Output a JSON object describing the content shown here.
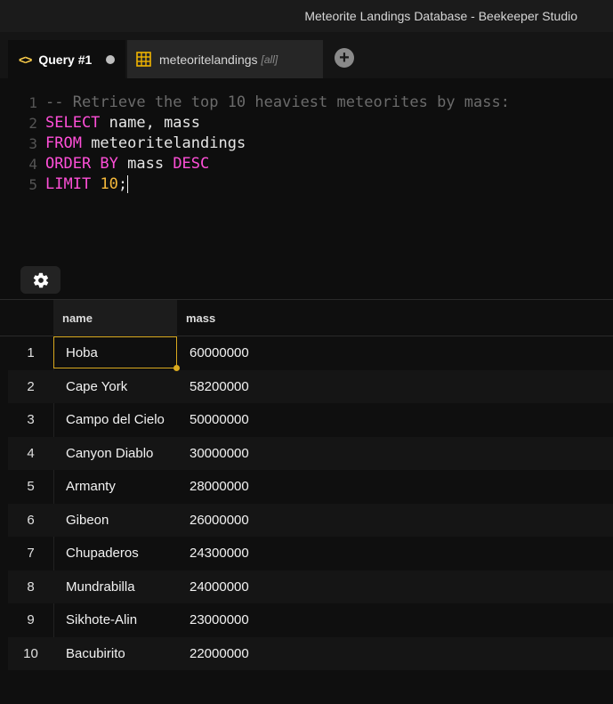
{
  "window": {
    "title": "Meteorite Landings Database - Beekeeper Studio"
  },
  "tabs": [
    {
      "label": "Query #1",
      "icon": "code-icon",
      "active": true,
      "unsaved": true
    },
    {
      "label": "meteoritelandings",
      "suffix": "[all]",
      "icon": "table-grid-icon",
      "active": false
    }
  ],
  "editor": {
    "line_numbers": [
      "1",
      "2",
      "3",
      "4",
      "5"
    ],
    "lines": [
      [
        {
          "t": "cm",
          "s": "-- Retrieve the top 10 heaviest meteorites by mass:"
        }
      ],
      [
        {
          "t": "kw",
          "s": "SELECT"
        },
        {
          "t": "tx",
          "s": " name, mass"
        }
      ],
      [
        {
          "t": "kw",
          "s": "FROM"
        },
        {
          "t": "tx",
          "s": " meteoritelandings"
        }
      ],
      [
        {
          "t": "kw",
          "s": "ORDER BY"
        },
        {
          "t": "tx",
          "s": " mass "
        },
        {
          "t": "kw",
          "s": "DESC"
        }
      ],
      [
        {
          "t": "kw",
          "s": "LIMIT"
        },
        {
          "t": "tx",
          "s": " "
        },
        {
          "t": "num",
          "s": "10"
        },
        {
          "t": "tx",
          "s": ";"
        }
      ]
    ]
  },
  "results": {
    "columns": [
      "name",
      "mass"
    ],
    "rows": [
      {
        "index": "1",
        "name": "Hoba",
        "mass": "60000000"
      },
      {
        "index": "2",
        "name": "Cape York",
        "mass": "58200000"
      },
      {
        "index": "3",
        "name": "Campo del Cielo",
        "mass": "50000000"
      },
      {
        "index": "4",
        "name": "Canyon Diablo",
        "mass": "30000000"
      },
      {
        "index": "5",
        "name": "Armanty",
        "mass": "28000000"
      },
      {
        "index": "6",
        "name": "Gibeon",
        "mass": "26000000"
      },
      {
        "index": "7",
        "name": "Chupaderos",
        "mass": "24300000"
      },
      {
        "index": "8",
        "name": "Mundrabilla",
        "mass": "24000000"
      },
      {
        "index": "9",
        "name": "Sikhote-Alin",
        "mass": "23000000"
      },
      {
        "index": "10",
        "name": "Bacubirito",
        "mass": "22000000"
      }
    ]
  },
  "colors": {
    "accent": "#ffd04b",
    "keyword": "#ff4fd8",
    "number": "#f6b93b",
    "comment": "#6b6b6b",
    "selection": "#d9a91e"
  }
}
